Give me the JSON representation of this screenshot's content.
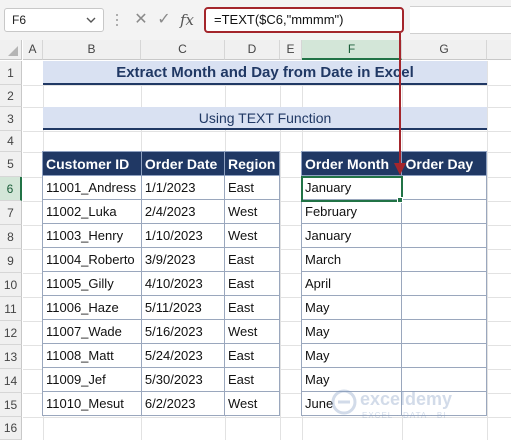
{
  "formula_bar": {
    "name_box": "F6",
    "formula": "=TEXT($C6,\"mmmm\")",
    "fx_label": "fx"
  },
  "columns": [
    "A",
    "B",
    "C",
    "D",
    "E",
    "F",
    "G"
  ],
  "rows": [
    "1",
    "2",
    "3",
    "4",
    "5",
    "6",
    "7",
    "8",
    "9",
    "10",
    "11",
    "12",
    "13",
    "14",
    "15",
    "16"
  ],
  "title": "Extract Month and Day from Date in Excel",
  "subtitle": "Using TEXT Function",
  "left_table": {
    "headers": [
      "Customer ID",
      "Order Date",
      "Region"
    ],
    "rows": [
      [
        "11001_Andress",
        "1/1/2023",
        "East"
      ],
      [
        "11002_Luka",
        "2/4/2023",
        "West"
      ],
      [
        "11003_Henry",
        "1/10/2023",
        "West"
      ],
      [
        "11004_Roberto",
        "3/9/2023",
        "East"
      ],
      [
        "11005_Gilly",
        "4/10/2023",
        "East"
      ],
      [
        "11006_Haze",
        "5/11/2023",
        "East"
      ],
      [
        "11007_Wade",
        "5/16/2023",
        "West"
      ],
      [
        "11008_Matt",
        "5/24/2023",
        "East"
      ],
      [
        "11009_Jef",
        "5/30/2023",
        "East"
      ],
      [
        "11010_Mesut",
        "6/2/2023",
        "West"
      ]
    ]
  },
  "right_table": {
    "headers": [
      "Order Month",
      "Order Day"
    ],
    "rows": [
      [
        "January",
        ""
      ],
      [
        "February",
        ""
      ],
      [
        "January",
        ""
      ],
      [
        "March",
        ""
      ],
      [
        "April",
        ""
      ],
      [
        "May",
        ""
      ],
      [
        "May",
        ""
      ],
      [
        "May",
        ""
      ],
      [
        "May",
        ""
      ],
      [
        "June",
        ""
      ]
    ]
  },
  "watermark": {
    "name": "exceldemy",
    "tagline": "EXCEL · DATA · BI"
  },
  "colors": {
    "header_bg": "#203864",
    "title_bg": "#d9e1f2",
    "selection": "#217346",
    "highlight": "#a4262c"
  }
}
